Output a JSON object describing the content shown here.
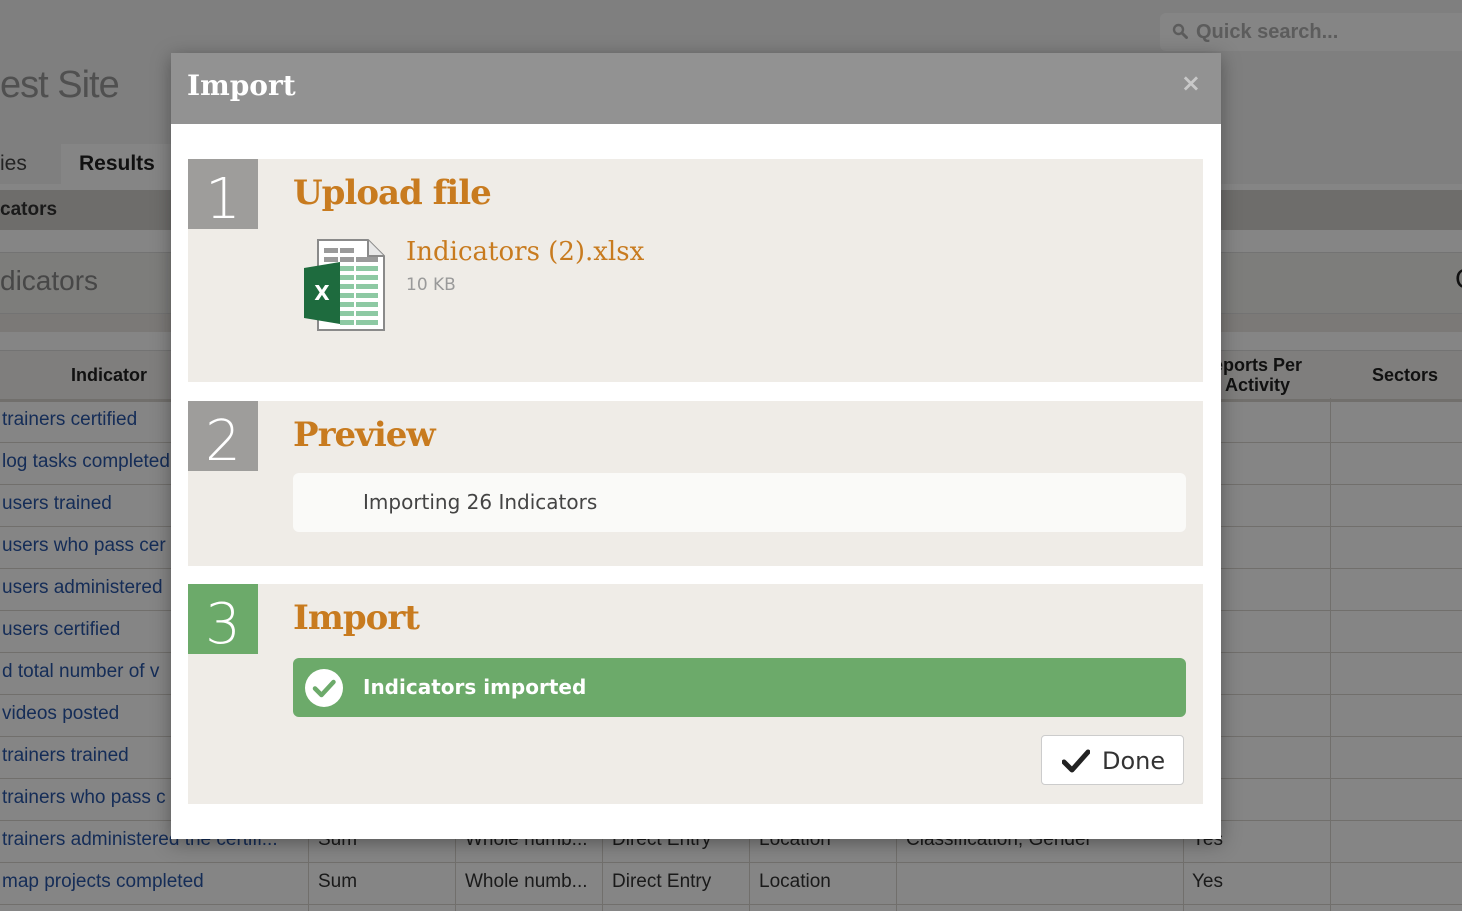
{
  "header": {
    "site_title": "est Site",
    "quick_search_placeholder": "Quick search..."
  },
  "tabs": {
    "partial_tab": "ies",
    "active_tab": "Results"
  },
  "section": {
    "title": "cators"
  },
  "filter": {
    "title": "dicators",
    "cut_char": "C"
  },
  "table": {
    "columns": {
      "indicator": "Indicator",
      "reports_per_activity": "eports Per Activity",
      "sectors": "Sectors"
    },
    "rows": [
      {
        "indicator": "trainers certified"
      },
      {
        "indicator": "log tasks completed"
      },
      {
        "indicator": "users trained"
      },
      {
        "indicator": " users who pass cer"
      },
      {
        "indicator": "users administered"
      },
      {
        "indicator": "users certified"
      },
      {
        "indicator": "d total number of v"
      },
      {
        "indicator": "videos posted"
      },
      {
        "indicator": "trainers trained"
      },
      {
        "indicator": " trainers who pass c"
      },
      {
        "indicator": "trainers administered the certifi...",
        "aggregation": "Sum",
        "type": "Whole numb...",
        "entry": "Direct Entry",
        "level": "Location",
        "disaggregation": "Classification, Gender",
        "reports": "Yes"
      },
      {
        "indicator": "map projects completed",
        "aggregation": "Sum",
        "type": "Whole numb...",
        "entry": "Direct Entry",
        "level": "Location",
        "disaggregation": "",
        "reports": "Yes"
      }
    ]
  },
  "modal": {
    "title": "Import",
    "close_symbol": "×",
    "step1": {
      "number": "1",
      "title": "Upload file",
      "file_name": "Indicators (2).xlsx",
      "file_size": "10 KB",
      "file_icon": "excel-file-icon"
    },
    "step2": {
      "number": "2",
      "title": "Preview",
      "message": "Importing 26 Indicators"
    },
    "step3": {
      "number": "3",
      "title": "Import",
      "status": "Indicators imported",
      "done_label": "Done"
    }
  },
  "colors": {
    "accent_orange": "#c87b1f",
    "success_green": "#6caa6a",
    "step_gray": "#9e9d9b",
    "link_blue": "#2a56a8"
  }
}
